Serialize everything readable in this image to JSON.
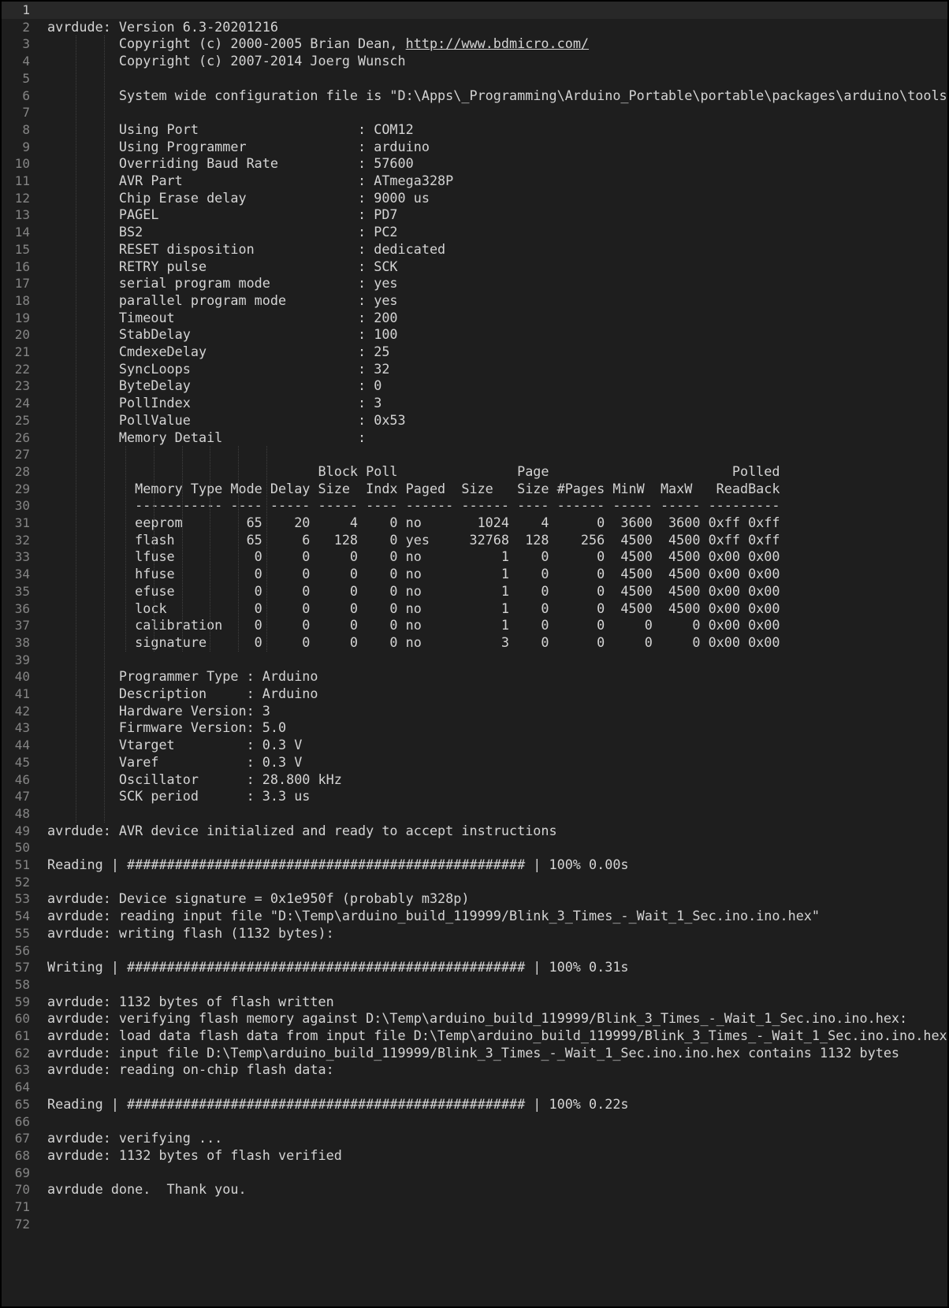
{
  "editor": {
    "current_line": 1,
    "lines": [
      "",
      "avrdude: Version 6.3-20201216",
      "         Copyright (c) 2000-2005 Brian Dean, http://www.bdmicro.com/",
      "         Copyright (c) 2007-2014 Joerg Wunsch",
      "",
      "         System wide configuration file is \"D:\\Apps\\_Programming\\Arduino_Portable\\portable\\packages\\arduino\\tools\\a",
      "",
      "         Using Port                    : COM12",
      "         Using Programmer              : arduino",
      "         Overriding Baud Rate          : 57600",
      "         AVR Part                      : ATmega328P",
      "         Chip Erase delay              : 9000 us",
      "         PAGEL                         : PD7",
      "         BS2                           : PC2",
      "         RESET disposition             : dedicated",
      "         RETRY pulse                   : SCK",
      "         serial program mode           : yes",
      "         parallel program mode         : yes",
      "         Timeout                       : 200",
      "         StabDelay                     : 100",
      "         CmdexeDelay                   : 25",
      "         SyncLoops                     : 32",
      "         ByteDelay                     : 0",
      "         PollIndex                     : 3",
      "         PollValue                     : 0x53",
      "         Memory Detail                 :",
      "",
      "                                  Block Poll               Page                       Polled",
      "           Memory Type Mode Delay Size  Indx Paged  Size   Size #Pages MinW  MaxW   ReadBack",
      "           ----------- ---- ----- ----- ---- ------ ------ ---- ------ ----- ----- ---------",
      "           eeprom        65    20     4    0 no       1024    4      0  3600  3600 0xff 0xff",
      "           flash         65     6   128    0 yes     32768  128    256  4500  4500 0xff 0xff",
      "           lfuse          0     0     0    0 no          1    0      0  4500  4500 0x00 0x00",
      "           hfuse          0     0     0    0 no          1    0      0  4500  4500 0x00 0x00",
      "           efuse          0     0     0    0 no          1    0      0  4500  4500 0x00 0x00",
      "           lock           0     0     0    0 no          1    0      0  4500  4500 0x00 0x00",
      "           calibration    0     0     0    0 no          1    0      0     0     0 0x00 0x00",
      "           signature      0     0     0    0 no          3    0      0     0     0 0x00 0x00",
      "",
      "         Programmer Type : Arduino",
      "         Description     : Arduino",
      "         Hardware Version: 3",
      "         Firmware Version: 5.0",
      "         Vtarget         : 0.3 V",
      "         Varef           : 0.3 V",
      "         Oscillator      : 28.800 kHz",
      "         SCK period      : 3.3 us",
      "",
      "avrdude: AVR device initialized and ready to accept instructions",
      "",
      "Reading | ################################################## | 100% 0.00s",
      "",
      "avrdude: Device signature = 0x1e950f (probably m328p)",
      "avrdude: reading input file \"D:\\Temp\\arduino_build_119999/Blink_3_Times_-_Wait_1_Sec.ino.ino.hex\"",
      "avrdude: writing flash (1132 bytes):",
      "",
      "Writing | ################################################## | 100% 0.31s",
      "",
      "avrdude: 1132 bytes of flash written",
      "avrdude: verifying flash memory against D:\\Temp\\arduino_build_119999/Blink_3_Times_-_Wait_1_Sec.ino.ino.hex:",
      "avrdude: load data flash data from input file D:\\Temp\\arduino_build_119999/Blink_3_Times_-_Wait_1_Sec.ino.ino.hex:",
      "avrdude: input file D:\\Temp\\arduino_build_119999/Blink_3_Times_-_Wait_1_Sec.ino.ino.hex contains 1132 bytes",
      "avrdude: reading on-chip flash data:",
      "",
      "Reading | ################################################## | 100% 0.22s",
      "",
      "avrdude: verifying ...",
      "avrdude: 1132 bytes of flash verified",
      "",
      "avrdude done.  Thank you.",
      "",
      ""
    ],
    "link_text": "http://www.bdmicro.com/"
  }
}
